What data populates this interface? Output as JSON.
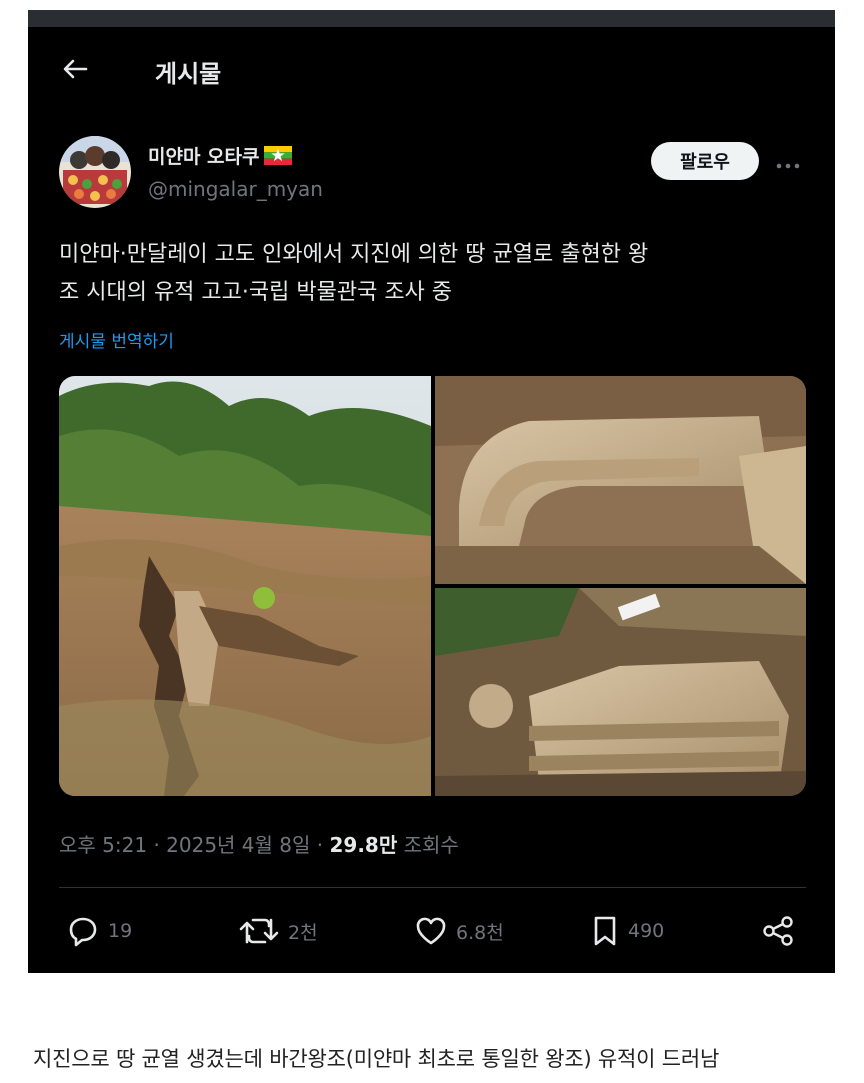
{
  "header": {
    "title": "게시물"
  },
  "author": {
    "display_name": "미얀마 오타쿠",
    "handle": "@mingalar_myan"
  },
  "follow_label": "팔로우",
  "post": {
    "text_line1": "미얀마·만달레이 고도 인와에서 지진에 의한 땅 균열로 출현한 왕",
    "text_line2": "조 시대의 유적 고고·국립 박물관국 조사 중",
    "translate_label": "게시물 번역하기"
  },
  "meta": {
    "time": "오후 5:21",
    "date": "2025년 4월 8일",
    "views_count": "29.8만",
    "views_label": "조회수"
  },
  "actions": {
    "replies": "19",
    "reposts": "2천",
    "likes": "6.8천",
    "bookmarks": "490"
  },
  "caption": "지진으로 땅 균열 생겼는데 바간왕조(미얀마 최초로 통일한 왕조) 유적이 드러남",
  "icons": [
    "back-arrow-icon",
    "myanmar-flag-icon",
    "more-icon",
    "reply-icon",
    "repost-icon",
    "like-icon",
    "bookmark-icon",
    "share-icon"
  ],
  "colors": {
    "background": "#000000",
    "text": "#e7e9ea",
    "muted": "#71767b",
    "link": "#1d9bf0",
    "follow_bg": "#eff3f4"
  }
}
